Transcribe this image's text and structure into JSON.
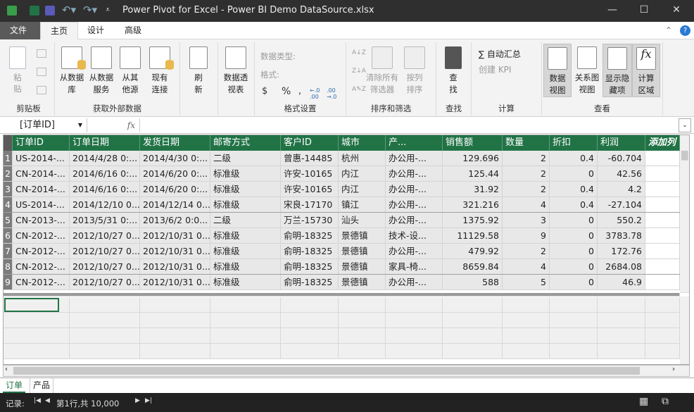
{
  "title": "Power Pivot for Excel - Power BI Demo DataSource.xlsx",
  "colors": {
    "header_green": "#217346",
    "titlebar": "#2f2f2f"
  },
  "tabs": [
    "文件",
    "主页",
    "设计",
    "高级"
  ],
  "active_tab": "主页",
  "ribbon": {
    "clipboard": {
      "label": "剪贴板",
      "paste": "粘贴"
    },
    "external": {
      "label": "获取外部数据",
      "b1": "从数据库",
      "b2": "从数据服务",
      "b3": "从其他源",
      "b4": "现有连接"
    },
    "refresh": "刷新",
    "pivot": "数据透视表",
    "format": {
      "label": "格式设置",
      "datatype": "数据类型:",
      "format": "格式:",
      "currency": "$",
      "percent": "%",
      "comma": ",",
      "inc": "←.0 .00",
      "dec": ".00 →.0"
    },
    "sort": {
      "label": "排序和筛选",
      "clear": "清除所有筛选器",
      "bycol": "按列排序"
    },
    "find": {
      "label": "查找",
      "btn": "查找"
    },
    "calc": {
      "label": "计算",
      "autosum": "∑ 自动汇总",
      "kpi": "创建 KPI"
    },
    "view": {
      "label": "查看",
      "data": "数据视图",
      "diagram": "关系图视图",
      "hidden": "显示隐藏项",
      "calcarea": "计算区域"
    }
  },
  "formula": {
    "name_box": "[订单ID]",
    "fx": "fx",
    "value": ""
  },
  "table": {
    "columns": [
      "订单ID",
      "订单日期",
      "发货日期",
      "邮寄方式",
      "客户ID",
      "城市",
      "产...",
      "销售额",
      "数量",
      "折扣",
      "利润"
    ],
    "add_column": "添加列",
    "rows": [
      [
        "US-2014-...",
        "2014/4/28 0:...",
        "2014/4/30 0:...",
        "二级",
        "曾惠-14485",
        "杭州",
        "办公用-...",
        "129.696",
        "2",
        "0.4",
        "-60.704"
      ],
      [
        "CN-2014-...",
        "2014/6/16 0:...",
        "2014/6/20 0:...",
        "标准级",
        "许安-10165",
        "内江",
        "办公用-...",
        "125.44",
        "2",
        "0",
        "42.56"
      ],
      [
        "CN-2014-...",
        "2014/6/16 0:...",
        "2014/6/20 0:...",
        "标准级",
        "许安-10165",
        "内江",
        "办公用-...",
        "31.92",
        "2",
        "0.4",
        "4.2"
      ],
      [
        "US-2014-...",
        "2014/12/10 0...",
        "2014/12/14 0...",
        "标准级",
        "宋良-17170",
        "镇江",
        "办公用-...",
        "321.216",
        "4",
        "0.4",
        "-27.104"
      ],
      [
        "CN-2013-...",
        "2013/5/31 0:...",
        "2013/6/2 0:0...",
        "二级",
        "万兰-15730",
        "汕头",
        "办公用-...",
        "1375.92",
        "3",
        "0",
        "550.2"
      ],
      [
        "CN-2012-...",
        "2012/10/27 0...",
        "2012/10/31 0...",
        "标准级",
        "俞明-18325",
        "景德镇",
        "技术-设...",
        "11129.58",
        "9",
        "0",
        "3783.78"
      ],
      [
        "CN-2012-...",
        "2012/10/27 0...",
        "2012/10/31 0...",
        "标准级",
        "俞明-18325",
        "景德镇",
        "办公用-...",
        "479.92",
        "2",
        "0",
        "172.76"
      ],
      [
        "CN-2012-...",
        "2012/10/27 0...",
        "2012/10/31 0...",
        "标准级",
        "俞明-18325",
        "景德镇",
        "家具-椅...",
        "8659.84",
        "4",
        "0",
        "2684.08"
      ],
      [
        "CN-2012-...",
        "2012/10/27 0...",
        "2012/10/31 0...",
        "标准级",
        "俞明-18325",
        "景德镇",
        "办公用-...",
        "588",
        "5",
        "0",
        "46.9"
      ]
    ]
  },
  "sheets": [
    "订单",
    "产品"
  ],
  "status": {
    "record": "记录:",
    "position": "第1行,共 10,000"
  }
}
